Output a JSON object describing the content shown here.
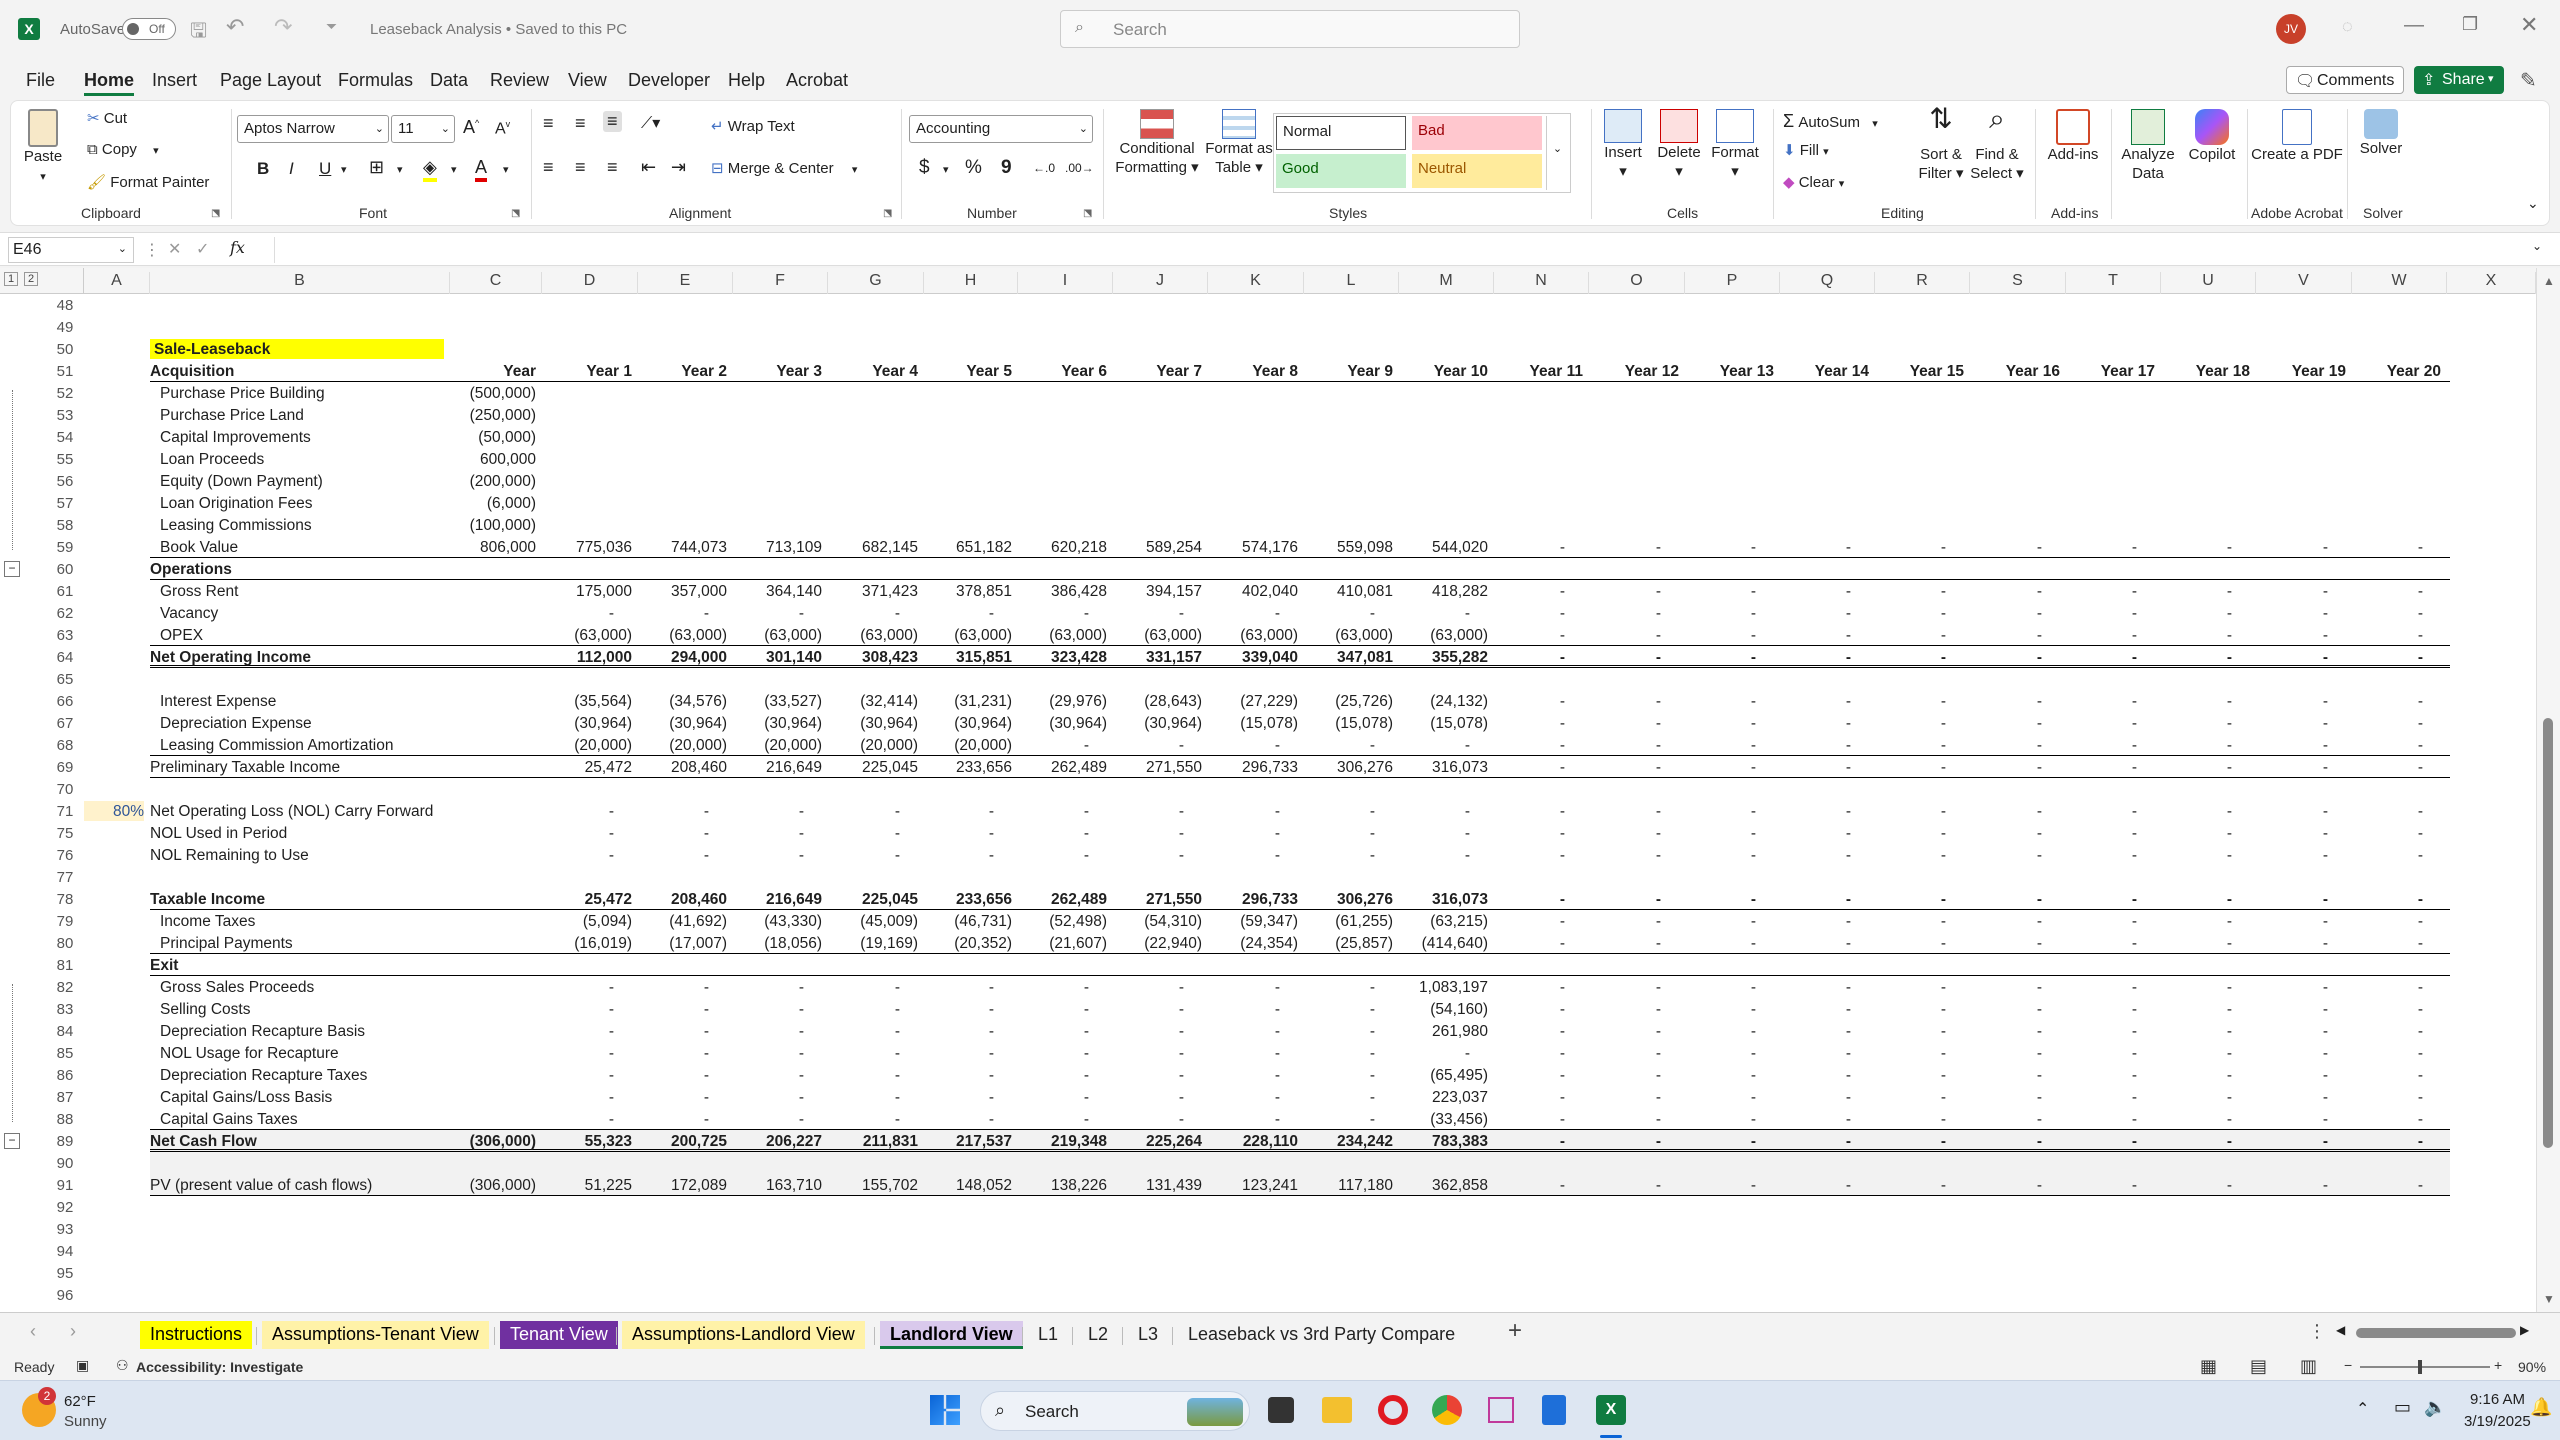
{
  "window": {
    "autosave_label": "AutoSave",
    "autosave_state": "Off",
    "doc_title": "Leaseback Analysis • Saved to this PC",
    "search_placeholder": "Search",
    "user_initials": "JV"
  },
  "menu": [
    "File",
    "Home",
    "Insert",
    "Page Layout",
    "Formulas",
    "Data",
    "Review",
    "View",
    "Developer",
    "Help",
    "Acrobat"
  ],
  "menu_right": {
    "comments": "Comments",
    "share": "Share"
  },
  "ribbon": {
    "clipboard": {
      "paste": "Paste",
      "cut": "Cut",
      "copy": "Copy",
      "format_painter": "Format Painter",
      "label": "Clipboard"
    },
    "font": {
      "name": "Aptos Narrow",
      "size": "11",
      "label": "Font",
      "bold": "B",
      "italic": "I",
      "underline": "U"
    },
    "alignment": {
      "wrap": "Wrap Text",
      "merge": "Merge & Center",
      "label": "Alignment"
    },
    "number": {
      "format": "Accounting",
      "label": "Number",
      "currency": "$",
      "percent": "%",
      "comma": "9"
    },
    "styles": {
      "conditional": "Conditional Formatting",
      "format_table": "Format as Table",
      "normal": "Normal",
      "bad": "Bad",
      "good": "Good",
      "neutral": "Neutral",
      "label": "Styles"
    },
    "cells": {
      "insert": "Insert",
      "delete": "Delete",
      "format": "Format",
      "label": "Cells"
    },
    "editing": {
      "autosum": "AutoSum",
      "fill": "Fill",
      "clear": "Clear",
      "sort": "Sort & Filter",
      "find": "Find & Select",
      "label": "Editing"
    },
    "addins": {
      "addins": "Add-ins",
      "label": "Add-ins"
    },
    "analyze": "Analyze Data",
    "copilot": "Copilot",
    "acrobat": {
      "create": "Create a PDF",
      "label": "Adobe Acrobat"
    },
    "solver": {
      "solver": "Solver",
      "label": "Solver"
    }
  },
  "formula_bar": {
    "name_box": "E46",
    "fx": "fx",
    "formula": ""
  },
  "columns": [
    "A",
    "B",
    "C",
    "D",
    "E",
    "F",
    "G",
    "H",
    "I",
    "J",
    "K",
    "L",
    "M",
    "N",
    "O",
    "P",
    "Q",
    "R",
    "S",
    "T",
    "U",
    "V",
    "W",
    "X"
  ],
  "row_numbers": [
    "48",
    "49",
    "50",
    "51",
    "52",
    "53",
    "54",
    "55",
    "56",
    "57",
    "58",
    "59",
    "60",
    "61",
    "62",
    "63",
    "64",
    "65",
    "66",
    "67",
    "68",
    "69",
    "70",
    "71",
    "75",
    "76",
    "77",
    "78",
    "79",
    "80",
    "81",
    "82",
    "83",
    "84",
    "85",
    "86",
    "87",
    "88",
    "89",
    "90",
    "91",
    "92",
    "93",
    "94",
    "95",
    "96"
  ],
  "sheet": {
    "title": "Sale-Leaseback",
    "headers": [
      "Year",
      "Year 1",
      "Year 2",
      "Year 3",
      "Year 4",
      "Year 5",
      "Year 6",
      "Year 7",
      "Year 8",
      "Year 9",
      "Year 10",
      "Year 11",
      "Year 12",
      "Year 13",
      "Year 14",
      "Year 15",
      "Year 16",
      "Year 17",
      "Year 18",
      "Year 19",
      "Year 20"
    ],
    "acquisition_label": "Acquisition",
    "pct_cell": "80%",
    "rows": [
      {
        "r": "52",
        "label": "Purchase Price Building",
        "c": "(500,000)",
        "vals": []
      },
      {
        "r": "53",
        "label": "Purchase Price Land",
        "c": "(250,000)",
        "vals": []
      },
      {
        "r": "54",
        "label": "Capital Improvements",
        "c": "(50,000)",
        "vals": []
      },
      {
        "r": "55",
        "label": "Loan Proceeds",
        "c": "600,000",
        "vals": []
      },
      {
        "r": "56",
        "label": "Equity (Down Payment)",
        "c": "(200,000)",
        "vals": []
      },
      {
        "r": "57",
        "label": "Loan Origination Fees",
        "c": "(6,000)",
        "vals": []
      },
      {
        "r": "58",
        "label": "Leasing Commissions",
        "c": "(100,000)",
        "vals": []
      },
      {
        "r": "59",
        "label": "Book Value",
        "c": "806,000",
        "vals": [
          "775,036",
          "744,073",
          "713,109",
          "682,145",
          "651,182",
          "620,218",
          "589,254",
          "574,176",
          "559,098",
          "544,020",
          "-",
          "-",
          "-",
          "-",
          "-",
          "-",
          "-",
          "-",
          "-",
          "-"
        ]
      },
      {
        "r": "60",
        "label": "Operations",
        "c": "",
        "vals": [],
        "section": true
      },
      {
        "r": "61",
        "label": "Gross Rent",
        "c": "",
        "vals": [
          "175,000",
          "357,000",
          "364,140",
          "371,423",
          "378,851",
          "386,428",
          "394,157",
          "402,040",
          "410,081",
          "418,282",
          "-",
          "-",
          "-",
          "-",
          "-",
          "-",
          "-",
          "-",
          "-",
          "-"
        ]
      },
      {
        "r": "62",
        "label": "Vacancy",
        "c": "",
        "vals": [
          "-",
          "-",
          "-",
          "-",
          "-",
          "-",
          "-",
          "-",
          "-",
          "-",
          "-",
          "-",
          "-",
          "-",
          "-",
          "-",
          "-",
          "-",
          "-",
          "-"
        ]
      },
      {
        "r": "63",
        "label": "OPEX",
        "c": "",
        "vals": [
          "(63,000)",
          "(63,000)",
          "(63,000)",
          "(63,000)",
          "(63,000)",
          "(63,000)",
          "(63,000)",
          "(63,000)",
          "(63,000)",
          "(63,000)",
          "-",
          "-",
          "-",
          "-",
          "-",
          "-",
          "-",
          "-",
          "-",
          "-"
        ]
      },
      {
        "r": "64",
        "label": "Net Operating Income",
        "c": "",
        "vals": [
          "112,000",
          "294,000",
          "301,140",
          "308,423",
          "315,851",
          "323,428",
          "331,157",
          "339,040",
          "347,081",
          "355,282",
          "-",
          "-",
          "-",
          "-",
          "-",
          "-",
          "-",
          "-",
          "-",
          "-"
        ],
        "bold": true
      },
      {
        "r": "65",
        "label": "",
        "c": "",
        "vals": []
      },
      {
        "r": "66",
        "label": "Interest Expense",
        "c": "",
        "vals": [
          "(35,564)",
          "(34,576)",
          "(33,527)",
          "(32,414)",
          "(31,231)",
          "(29,976)",
          "(28,643)",
          "(27,229)",
          "(25,726)",
          "(24,132)",
          "-",
          "-",
          "-",
          "-",
          "-",
          "-",
          "-",
          "-",
          "-",
          "-"
        ]
      },
      {
        "r": "67",
        "label": "Depreciation Expense",
        "c": "",
        "vals": [
          "(30,964)",
          "(30,964)",
          "(30,964)",
          "(30,964)",
          "(30,964)",
          "(30,964)",
          "(30,964)",
          "(15,078)",
          "(15,078)",
          "(15,078)",
          "-",
          "-",
          "-",
          "-",
          "-",
          "-",
          "-",
          "-",
          "-",
          "-"
        ]
      },
      {
        "r": "68",
        "label": "Leasing Commission Amortization",
        "c": "",
        "vals": [
          "(20,000)",
          "(20,000)",
          "(20,000)",
          "(20,000)",
          "(20,000)",
          "-",
          "-",
          "-",
          "-",
          "-",
          "-",
          "-",
          "-",
          "-",
          "-",
          "-",
          "-",
          "-",
          "-",
          "-"
        ]
      },
      {
        "r": "69",
        "label": "Preliminary Taxable Income",
        "c": "",
        "vals": [
          "25,472",
          "208,460",
          "216,649",
          "225,045",
          "233,656",
          "262,489",
          "271,550",
          "296,733",
          "306,276",
          "316,073",
          "-",
          "-",
          "-",
          "-",
          "-",
          "-",
          "-",
          "-",
          "-",
          "-"
        ],
        "noindent": true
      },
      {
        "r": "70",
        "label": "",
        "c": "",
        "vals": []
      },
      {
        "r": "71",
        "label": "Net Operating Loss (NOL) Carry Forward",
        "c": "",
        "vals": [
          "-",
          "-",
          "-",
          "-",
          "-",
          "-",
          "-",
          "-",
          "-",
          "-",
          "-",
          "-",
          "-",
          "-",
          "-",
          "-",
          "-",
          "-",
          "-",
          "-"
        ],
        "noindent": true
      },
      {
        "r": "75",
        "label": "NOL Used in Period",
        "c": "",
        "vals": [
          "-",
          "-",
          "-",
          "-",
          "-",
          "-",
          "-",
          "-",
          "-",
          "-",
          "-",
          "-",
          "-",
          "-",
          "-",
          "-",
          "-",
          "-",
          "-",
          "-"
        ],
        "noindent": true
      },
      {
        "r": "76",
        "label": "NOL Remaining to Use",
        "c": "",
        "vals": [
          "-",
          "-",
          "-",
          "-",
          "-",
          "-",
          "-",
          "-",
          "-",
          "-",
          "-",
          "-",
          "-",
          "-",
          "-",
          "-",
          "-",
          "-",
          "-",
          "-"
        ],
        "noindent": true
      },
      {
        "r": "77",
        "label": "",
        "c": "",
        "vals": []
      },
      {
        "r": "78",
        "label": "Taxable Income",
        "c": "",
        "vals": [
          "25,472",
          "208,460",
          "216,649",
          "225,045",
          "233,656",
          "262,489",
          "271,550",
          "296,733",
          "306,276",
          "316,073",
          "-",
          "-",
          "-",
          "-",
          "-",
          "-",
          "-",
          "-",
          "-",
          "-"
        ],
        "bold": true,
        "noindent": true
      },
      {
        "r": "79",
        "label": "Income Taxes",
        "c": "",
        "vals": [
          "(5,094)",
          "(41,692)",
          "(43,330)",
          "(45,009)",
          "(46,731)",
          "(52,498)",
          "(54,310)",
          "(59,347)",
          "(61,255)",
          "(63,215)",
          "-",
          "-",
          "-",
          "-",
          "-",
          "-",
          "-",
          "-",
          "-",
          "-"
        ]
      },
      {
        "r": "80",
        "label": "Principal Payments",
        "c": "",
        "vals": [
          "(16,019)",
          "(17,007)",
          "(18,056)",
          "(19,169)",
          "(20,352)",
          "(21,607)",
          "(22,940)",
          "(24,354)",
          "(25,857)",
          "(414,640)",
          "-",
          "-",
          "-",
          "-",
          "-",
          "-",
          "-",
          "-",
          "-",
          "-"
        ]
      },
      {
        "r": "81",
        "label": "Exit",
        "c": "",
        "vals": [],
        "section": true
      },
      {
        "r": "82",
        "label": "Gross Sales Proceeds",
        "c": "",
        "vals": [
          "-",
          "-",
          "-",
          "-",
          "-",
          "-",
          "-",
          "-",
          "-",
          "1,083,197",
          "-",
          "-",
          "-",
          "-",
          "-",
          "-",
          "-",
          "-",
          "-",
          "-"
        ]
      },
      {
        "r": "83",
        "label": "Selling Costs",
        "c": "",
        "vals": [
          "-",
          "-",
          "-",
          "-",
          "-",
          "-",
          "-",
          "-",
          "-",
          "(54,160)",
          "-",
          "-",
          "-",
          "-",
          "-",
          "-",
          "-",
          "-",
          "-",
          "-"
        ]
      },
      {
        "r": "84",
        "label": "Depreciation Recapture Basis",
        "c": "",
        "vals": [
          "-",
          "-",
          "-",
          "-",
          "-",
          "-",
          "-",
          "-",
          "-",
          "261,980",
          "-",
          "-",
          "-",
          "-",
          "-",
          "-",
          "-",
          "-",
          "-",
          "-"
        ]
      },
      {
        "r": "85",
        "label": "NOL Usage for Recapture",
        "c": "",
        "vals": [
          "-",
          "-",
          "-",
          "-",
          "-",
          "-",
          "-",
          "-",
          "-",
          "-",
          "-",
          "-",
          "-",
          "-",
          "-",
          "-",
          "-",
          "-",
          "-",
          "-"
        ]
      },
      {
        "r": "86",
        "label": "Depreciation Recapture Taxes",
        "c": "",
        "vals": [
          "-",
          "-",
          "-",
          "-",
          "-",
          "-",
          "-",
          "-",
          "-",
          "(65,495)",
          "-",
          "-",
          "-",
          "-",
          "-",
          "-",
          "-",
          "-",
          "-",
          "-"
        ]
      },
      {
        "r": "87",
        "label": "Capital Gains/Loss Basis",
        "c": "",
        "vals": [
          "-",
          "-",
          "-",
          "-",
          "-",
          "-",
          "-",
          "-",
          "-",
          "223,037",
          "-",
          "-",
          "-",
          "-",
          "-",
          "-",
          "-",
          "-",
          "-",
          "-"
        ]
      },
      {
        "r": "88",
        "label": "Capital Gains Taxes",
        "c": "",
        "vals": [
          "-",
          "-",
          "-",
          "-",
          "-",
          "-",
          "-",
          "-",
          "-",
          "(33,456)",
          "-",
          "-",
          "-",
          "-",
          "-",
          "-",
          "-",
          "-",
          "-",
          "-"
        ]
      },
      {
        "r": "89",
        "label": "Net Cash Flow",
        "c": "(306,000)",
        "vals": [
          "55,323",
          "200,725",
          "206,227",
          "211,831",
          "217,537",
          "219,348",
          "225,264",
          "228,110",
          "234,242",
          "783,383",
          "-",
          "-",
          "-",
          "-",
          "-",
          "-",
          "-",
          "-",
          "-",
          "-"
        ],
        "bold": true,
        "noindent": true
      },
      {
        "r": "90",
        "label": "",
        "c": "",
        "vals": []
      },
      {
        "r": "91",
        "label": "PV (present value of cash flows)",
        "c": "(306,000)",
        "vals": [
          "51,225",
          "172,089",
          "163,710",
          "155,702",
          "148,052",
          "138,226",
          "131,439",
          "123,241",
          "117,180",
          "362,858",
          "-",
          "-",
          "-",
          "-",
          "-",
          "-",
          "-",
          "-",
          "-",
          "-"
        ],
        "noindent": true
      }
    ]
  },
  "sheet_tabs": [
    {
      "label": "Instructions",
      "bg": "#ffff00",
      "fg": "#000"
    },
    {
      "label": "Assumptions-Tenant View",
      "bg": "#fff2a8",
      "fg": "#000"
    },
    {
      "label": "Tenant View",
      "bg": "#7030a0",
      "fg": "#fff"
    },
    {
      "label": "Assumptions-Landlord View",
      "bg": "#fff2a8",
      "fg": "#000"
    },
    {
      "label": "Landlord View",
      "bg": "#d9c9ec",
      "fg": "#000",
      "active": true
    },
    {
      "label": "L1",
      "bg": "",
      "fg": "#222"
    },
    {
      "label": "L2",
      "bg": "",
      "fg": "#222"
    },
    {
      "label": "L3",
      "bg": "",
      "fg": "#222"
    },
    {
      "label": "Leaseback vs 3rd Party Compare",
      "bg": "",
      "fg": "#222"
    }
  ],
  "status": {
    "ready": "Ready",
    "accessibility": "Accessibility: Investigate",
    "zoom": "90%"
  },
  "taskbar": {
    "temp": "62°F",
    "weather": "Sunny",
    "search": "Search",
    "time": "9:16 AM",
    "date": "3/19/2025",
    "badge": "2"
  },
  "colors": {
    "excel_green": "#107c41",
    "yellow": "#ffff00",
    "purple": "#7030a0"
  }
}
